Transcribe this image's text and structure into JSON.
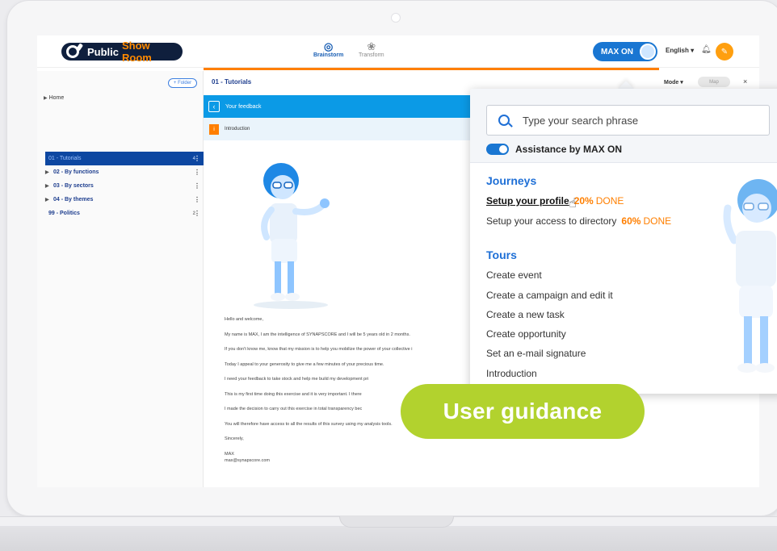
{
  "header": {
    "logo_text": "Public",
    "logo_accent": "Show Room",
    "tabs": [
      {
        "label": "Brainstorm",
        "active": true,
        "icon": "fingerprint-icon"
      },
      {
        "label": "Transform",
        "active": false,
        "icon": "flower-icon"
      }
    ],
    "assistant_button": "MAX ON",
    "language": "English ▾",
    "bell_icon": "bell-icon",
    "edit_icon": "edit-icon"
  },
  "sidebar": {
    "folder_button": "+ Folder",
    "home": "Home",
    "items": [
      {
        "label": "01 - Tutorials",
        "count": "4",
        "selected": true,
        "has_children": false
      },
      {
        "label": "02 - By functions",
        "count": "",
        "selected": false,
        "has_children": true
      },
      {
        "label": "03 - By sectors",
        "count": "",
        "selected": false,
        "has_children": true
      },
      {
        "label": "04 - By themes",
        "count": "",
        "selected": false,
        "has_children": true
      },
      {
        "label": "99 - Politics",
        "count": "2",
        "selected": false,
        "has_children": false
      }
    ]
  },
  "content": {
    "breadcrumb": "01 - Tutorials",
    "mode_label": "Mode ▾",
    "map_button": "Map",
    "close": "×",
    "feedback_title": "Your feedback",
    "intro_badge": "i",
    "intro_label": "Introduction",
    "letter": [
      "Hello and welcome,",
      "My name is MAX, I am the intelligence of SYNAPSCORE and I will be 5 years old in 2 months.",
      "If you don't know me, know that my mission is to help you mobilize the power of your collective i",
      "Today I appeal to your generosity to give me a few minutes of your precious time.",
      "I need your feedback to take stock and help me build my development pri",
      "This is my first time doing this exercise and it is very important. I there",
      "I made the decision to carry out this exercise in total transparency bec                                                                                                                              t I will be able to continue to grow.",
      "You will therefore have access to all the results of this survey using my analysis tools.",
      "Sincerely,"
    ],
    "signature_name": "MAX",
    "signature_email": "max@synapscore.com"
  },
  "popup": {
    "search_placeholder": "Type your search phrase",
    "assistance_label": "Assistance by MAX ON",
    "journeys_title": "Journeys",
    "journeys": [
      {
        "label": "Setup your profile",
        "pct": "20%",
        "done": "DONE"
      },
      {
        "label": "Setup your access to directory",
        "pct": "60%",
        "done": "DONE"
      }
    ],
    "tours_title": "Tours",
    "tours": [
      "Create event",
      "Create a campaign and edit it",
      "Create a new task",
      "Create opportunity",
      "Set an e-mail signature",
      "Introduction"
    ]
  },
  "banner": {
    "text": "User guidance"
  },
  "colors": {
    "brand_navy": "#0f1f3d",
    "accent_orange": "#ff7f00",
    "primary_blue": "#1976d2",
    "banner_green": "#b2d22e"
  }
}
